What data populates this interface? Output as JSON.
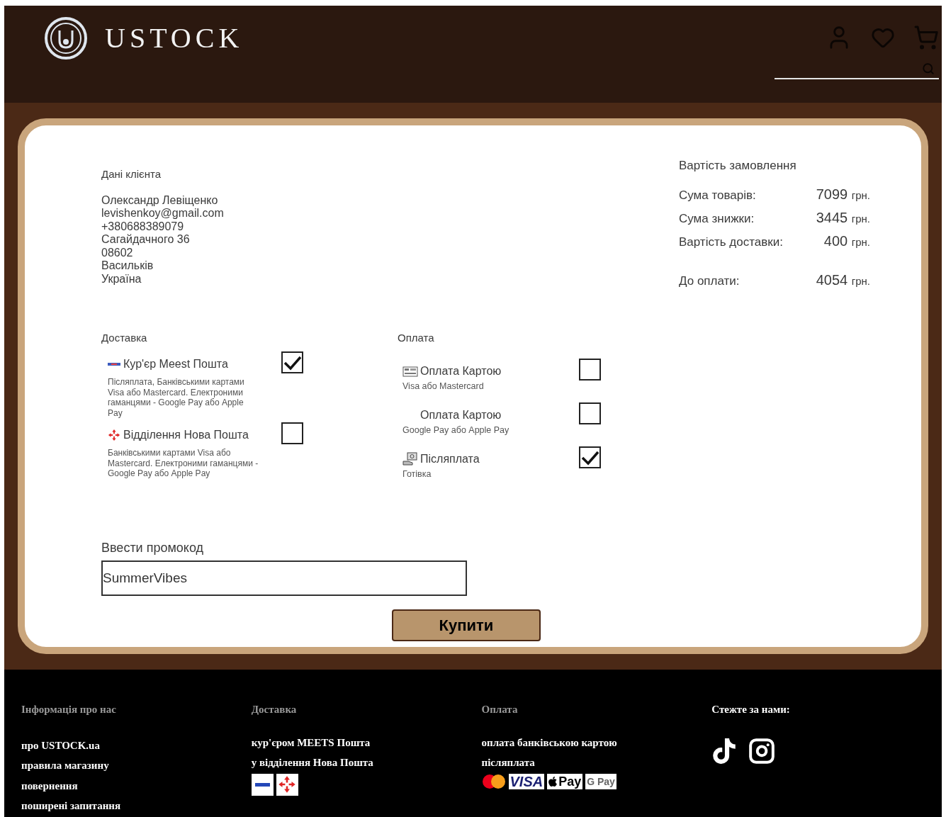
{
  "header": {
    "brand": "USTOCK"
  },
  "client": {
    "title": "Дані клієнта",
    "lines": [
      "Олександр Левіщенко",
      "levishenkoy@gmail.com",
      "+380688389079",
      "Сагайдачного 36",
      "08602",
      "Васильків",
      "Україна"
    ]
  },
  "summary": {
    "title": "Вартість замовлення",
    "rows": [
      {
        "label": "Сума товарів:",
        "value": "7099",
        "unit": "грн.",
        "kind": "line"
      },
      {
        "label": "Сума знижки:",
        "value": "3445",
        "unit": "грн.",
        "kind": "line"
      },
      {
        "label": "Вартість доставки:",
        "value": "400",
        "unit": "грн.",
        "kind": "line"
      },
      {
        "label": "До оплати:",
        "value": "4054",
        "unit": "грн.",
        "kind": "total"
      }
    ]
  },
  "delivery": {
    "title": "Доставка",
    "options": [
      {
        "kind": "meest",
        "title": "Кур'єр Meest Пошта",
        "description": "Післяплата, Банківськими картами Visa або Mastercard. Електроними гаманцями - Google Pay або Apple Pay",
        "checked": true
      },
      {
        "kind": "novaposhta",
        "title": "Відділення Нова Пошта",
        "description": "Банківськими картами Visa або Mastercard. Електроними гаманцями - Google Pay або Apple Pay",
        "checked": false
      }
    ]
  },
  "payment": {
    "title": "Оплата",
    "options": [
      {
        "kind": "card",
        "title": "Оплата Картою",
        "description": "Visa або Mastercard",
        "checked": false
      },
      {
        "kind": "none",
        "title": "Оплата Картою",
        "description": "Google Pay або Apple Pay",
        "checked": false
      },
      {
        "kind": "cash",
        "title": "Післяплата",
        "description": "Готівка",
        "checked": true
      }
    ]
  },
  "promo": {
    "label": "Ввести промокод",
    "value": "SummerVibes"
  },
  "buy_button": "Купити",
  "footer": {
    "columns": [
      {
        "title": "Інформація про нас",
        "links": [
          "про USTOCK.ua",
          "правила магазину",
          "повернення",
          "поширені запитання"
        ]
      },
      {
        "title": "Доставка",
        "links": [
          "кур'єром MEETS Пошта",
          "у відділення Нова Пошта"
        ],
        "logos": [
          {
            "kind": "meest"
          },
          {
            "kind": "novaposhta"
          }
        ]
      },
      {
        "title": "Оплата",
        "links": [
          "оплата банківською картою",
          "післяплата"
        ],
        "logos": [
          {
            "kind": "mastercard"
          },
          {
            "kind": "visa",
            "label": "VISA"
          },
          {
            "kind": "applepay",
            "label": "Pay"
          },
          {
            "kind": "gpay",
            "label": "G Pay"
          }
        ]
      },
      {
        "title": "Стежте за нами:",
        "socials": [
          {
            "kind": "tiktok"
          },
          {
            "kind": "instagram"
          }
        ]
      }
    ]
  }
}
